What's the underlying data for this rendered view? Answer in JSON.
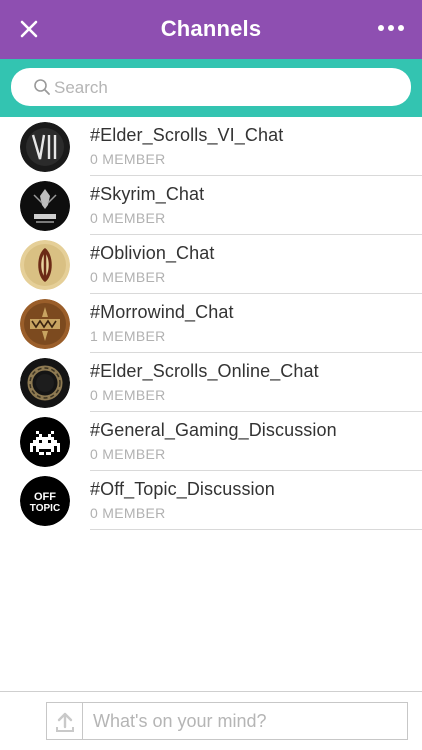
{
  "header": {
    "title": "Channels",
    "close_icon": "close-icon",
    "more_icon": "more-horizontal-icon",
    "background": "#8e4fb1"
  },
  "search": {
    "placeholder": "Search",
    "icon": "search-icon",
    "bar_color": "#33c4b1"
  },
  "channels": [
    {
      "name": "#Elder_Scrolls_VI_Chat",
      "members": "0 MEMBER",
      "avatar": "elder-scrolls-vi-logo"
    },
    {
      "name": "#Skyrim_Chat",
      "members": "0 MEMBER",
      "avatar": "skyrim-logo"
    },
    {
      "name": "#Oblivion_Chat",
      "members": "0 MEMBER",
      "avatar": "oblivion-logo"
    },
    {
      "name": "#Morrowind_Chat",
      "members": "1 MEMBER",
      "avatar": "morrowind-logo"
    },
    {
      "name": "#Elder_Scrolls_Online_Chat",
      "members": "0 MEMBER",
      "avatar": "elder-scrolls-online-logo"
    },
    {
      "name": "#General_Gaming_Discussion",
      "members": "0 MEMBER",
      "avatar": "space-invader-logo"
    },
    {
      "name": "#Off_Topic_Discussion",
      "members": "0 MEMBER",
      "avatar": "off-topic-logo",
      "avatar_text": [
        "OFF",
        "TOPIC"
      ]
    }
  ],
  "composer": {
    "placeholder": "What's on your mind?",
    "upload_icon": "upload-icon"
  }
}
